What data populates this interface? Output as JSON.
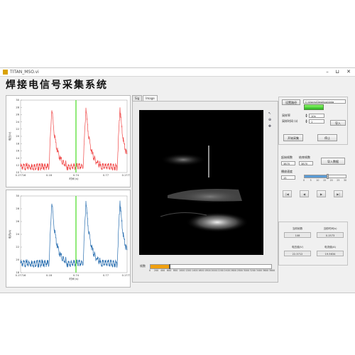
{
  "window": {
    "title": "TITAN_MSO.vi",
    "minimize": "–",
    "restore": "⊔",
    "close": "✕"
  },
  "app_title": "焊接电信号采集系统",
  "charts": [
    {
      "name": "voltage",
      "color": "#f04848",
      "ylabel": "电压(V)",
      "xlabel": "时间 (s)",
      "yticks": [
        "30",
        "28",
        "26",
        "24",
        "22",
        "20",
        "18",
        "16",
        "14",
        "12",
        "10"
      ],
      "xticks": [
        "0.17716",
        "0.18",
        "0.74",
        "0.77",
        "0.17733"
      ],
      "cursor_color": "#60e040"
    },
    {
      "name": "current",
      "color": "#2a6fb0",
      "ylabel": "电流(A)",
      "xlabel": "时间 (s)",
      "yticks": [
        "30",
        "28",
        "26",
        "24",
        "22",
        "20",
        "18"
      ],
      "xticks": [
        "0.17716",
        "0.18",
        "0.74",
        "0.77",
        "0.17733"
      ],
      "cursor_color": "#60e040"
    }
  ],
  "image_panel": {
    "tabs": [
      "Sig",
      "Image"
    ],
    "frame_label": "帧数",
    "frame_position": 0.15,
    "frame_ticks": [
      "0",
      "200",
      "400",
      "600",
      "800",
      "1000",
      "1200",
      "1400",
      "1600",
      "1800",
      "2000",
      "2200",
      "2400",
      "2600",
      "2800",
      "3000",
      "3200",
      "3400",
      "3600",
      "3800"
    ],
    "tool_icons": [
      "pointer-icon",
      "zoom-icon",
      "pan-icon"
    ]
  },
  "right_panel": {
    "save_path_button": "设置路径",
    "save_path_value": "C:\\Users\\Desktop\\data",
    "sample_rate_label": "采样率",
    "sample_rate_value": "10k",
    "sample_time_label": "采样时间 (s)",
    "sample_time_value": "1",
    "start_button": "开始采集",
    "stop_button": "停止",
    "start_frame_label": "起始帧数",
    "end_frame_label": "结束帧数",
    "start_frame_value": "3870",
    "end_frame_value": "3870",
    "import_button": "导入数据",
    "play_speed_label": "播放速度",
    "play_speed_value": "15",
    "play_slider_position": 0.55,
    "play_ticks": [
      "0",
      "5",
      "10",
      "15",
      "20",
      "25",
      "30"
    ],
    "nav_buttons": [
      "|◀",
      "◀",
      "▶",
      "▶|"
    ],
    "stat_labels": [
      "当前帧数",
      "当前时间(s)",
      "电压值(V)",
      "电流值(A)"
    ],
    "stat_values": [
      "108",
      "0.1573",
      "22.3712",
      "19.5634"
    ]
  }
}
